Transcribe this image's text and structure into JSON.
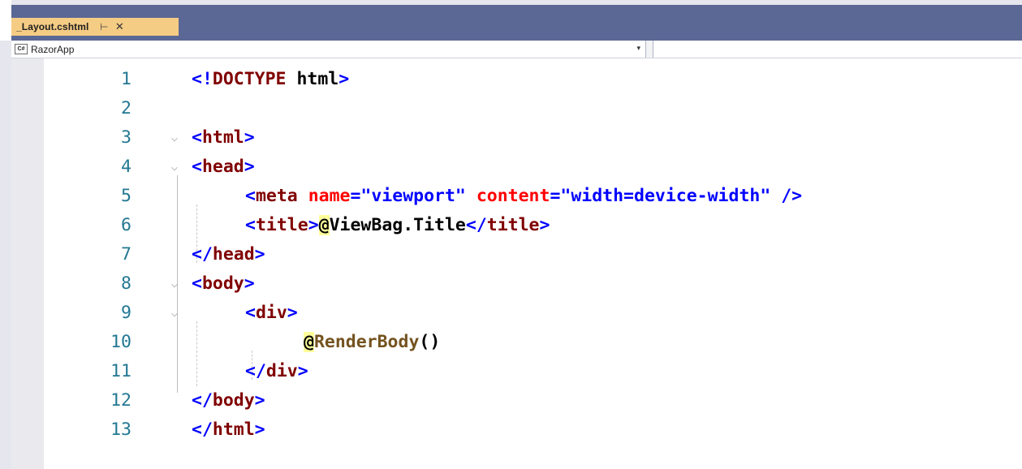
{
  "tab": {
    "label": "_Layout.cshtml",
    "pin_glyph": "⊥",
    "close_glyph": "✕"
  },
  "navbar": {
    "project_icon_text": "C#",
    "project_name": "RazorApp",
    "dropdown_glyph": "▾"
  },
  "editor": {
    "lines": [
      {
        "n": "1"
      },
      {
        "n": "2"
      },
      {
        "n": "3"
      },
      {
        "n": "4"
      },
      {
        "n": "5"
      },
      {
        "n": "6"
      },
      {
        "n": "7"
      },
      {
        "n": "8"
      },
      {
        "n": "9"
      },
      {
        "n": "10"
      },
      {
        "n": "11"
      },
      {
        "n": "12"
      },
      {
        "n": "13"
      }
    ],
    "code": {
      "l1": {
        "open": "<!",
        "tag": "DOCTYPE",
        "rest": " html",
        "close": ">"
      },
      "l3": {
        "open": "<",
        "tag": "html",
        "close": ">"
      },
      "l4": {
        "open": "<",
        "tag": "head",
        "close": ">"
      },
      "l5": {
        "open": "<",
        "tag": "meta",
        "attr1": "name",
        "eq1": "=",
        "val1": "\"viewport\"",
        "attr2": "content",
        "eq2": "=",
        "val2": "\"width=device-width\"",
        "close": " />"
      },
      "l6": {
        "open": "<",
        "tag": "title",
        "gt": ">",
        "at": "@",
        "expr": "ViewBag.Title",
        "copen": "</",
        "ctag": "title",
        "cclose": ">"
      },
      "l7": {
        "open": "</",
        "tag": "head",
        "close": ">"
      },
      "l8": {
        "open": "<",
        "tag": "body",
        "close": ">"
      },
      "l9": {
        "open": "<",
        "tag": "div",
        "close": ">"
      },
      "l10": {
        "at": "@",
        "method": "RenderBody",
        "parens": "()"
      },
      "l11": {
        "open": "</",
        "tag": "div",
        "close": ">"
      },
      "l12": {
        "open": "</",
        "tag": "body",
        "close": ">"
      },
      "l13": {
        "open": "</",
        "tag": "html",
        "close": ">"
      }
    },
    "fold_glyph": "⌵"
  },
  "colors": {
    "tag": "#800000",
    "punct": "#0000ff",
    "attr": "#ff0000",
    "string": "#0000ff",
    "line_number": "#237893",
    "tab_active": "#f5cc84",
    "tab_band": "#5b6895",
    "razor_highlight": "#ffff9a",
    "method": "#74531f"
  }
}
